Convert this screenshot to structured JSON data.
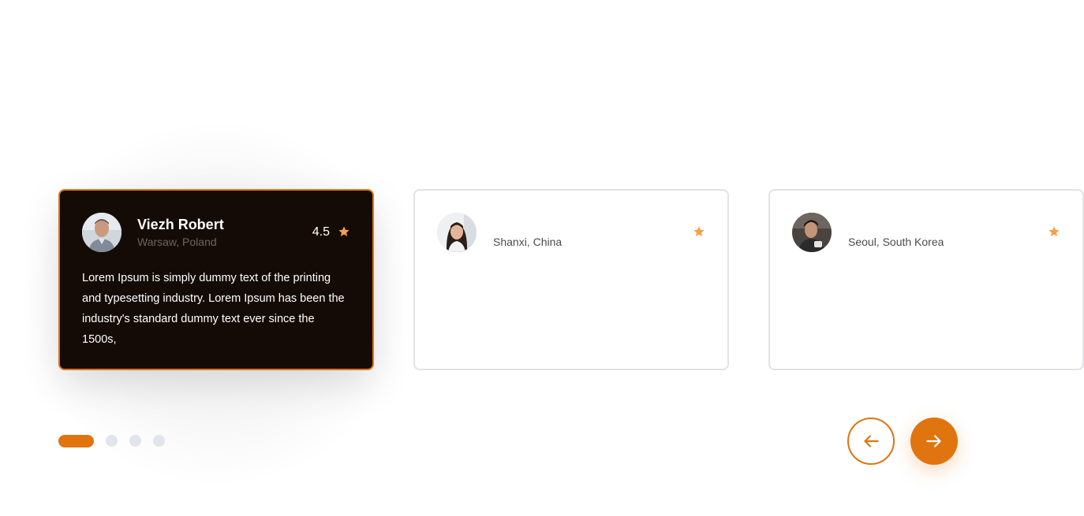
{
  "testimonials": [
    {
      "name": "Viezh Robert",
      "location": "Warsaw, Poland",
      "rating": "4.5",
      "text": "Lorem Ipsum is simply dummy text of the printing and typesetting industry. Lorem Ipsum has been the industry's standard dummy text ever since the 1500s,"
    },
    {
      "name": "",
      "location": "Shanxi, China",
      "rating": "",
      "text": ""
    },
    {
      "name": "",
      "location": "Seoul, South Korea",
      "rating": "",
      "text": ""
    }
  ],
  "pagination": {
    "total": 4,
    "active": 0
  },
  "icons": {
    "star": "star-icon",
    "prev": "arrow-left-icon",
    "next": "arrow-right-icon"
  },
  "colors": {
    "accent": "#e0740f",
    "star": "#f5a04a",
    "active_card_bg": "#140b06",
    "inactive_border": "#e3e3e6",
    "dot_inactive": "#e1e4ea"
  }
}
